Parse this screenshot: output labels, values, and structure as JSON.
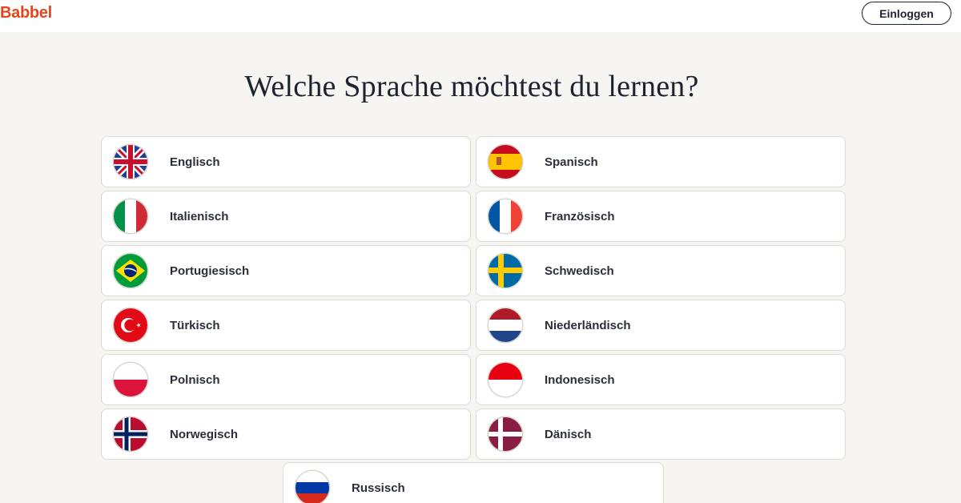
{
  "header": {
    "logo_text": "Babbel",
    "login_label": "Einloggen",
    "brand_color": "#e2451f"
  },
  "main": {
    "title": "Welche Sprache möchtest du lernen?"
  },
  "languages": [
    {
      "label": "Englisch",
      "flag": "uk-flag-icon"
    },
    {
      "label": "Spanisch",
      "flag": "spain-flag-icon"
    },
    {
      "label": "Italienisch",
      "flag": "italy-flag-icon"
    },
    {
      "label": "Französisch",
      "flag": "france-flag-icon"
    },
    {
      "label": "Portugiesisch",
      "flag": "brazil-flag-icon"
    },
    {
      "label": "Schwedisch",
      "flag": "sweden-flag-icon"
    },
    {
      "label": "Türkisch",
      "flag": "turkey-flag-icon"
    },
    {
      "label": "Niederländisch",
      "flag": "netherlands-flag-icon"
    },
    {
      "label": "Polnisch",
      "flag": "poland-flag-icon"
    },
    {
      "label": "Indonesisch",
      "flag": "indonesia-flag-icon"
    },
    {
      "label": "Norwegisch",
      "flag": "norway-flag-icon"
    },
    {
      "label": "Dänisch",
      "flag": "denmark-flag-icon"
    },
    {
      "label": "Russisch",
      "flag": "russia-flag-icon"
    }
  ]
}
